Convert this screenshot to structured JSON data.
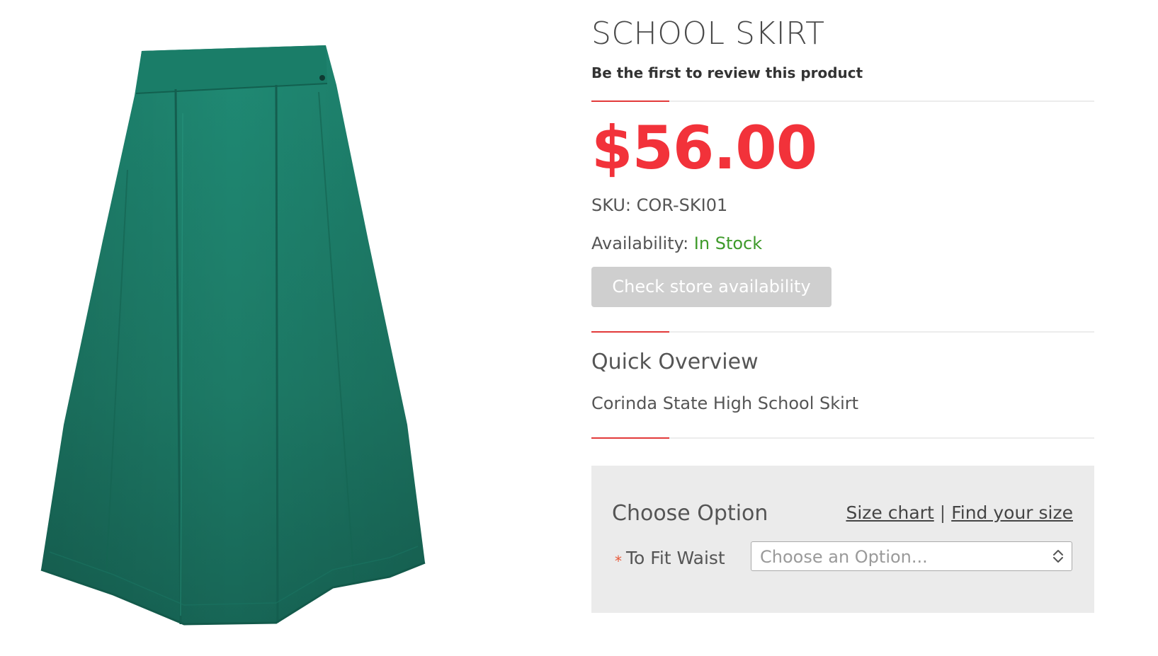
{
  "product": {
    "title": "SCHOOL SKIRT",
    "review_prompt": "Be the first to review this product",
    "price": "$56.00",
    "sku_label": "SKU:",
    "sku_value": "COR-SKI01",
    "availability_label": "Availability:",
    "availability_value": "In Stock",
    "check_store_label": "Check store availability",
    "image_color": "#1f7a66"
  },
  "overview": {
    "heading": "Quick Overview",
    "text": "Corinda State High School Skirt"
  },
  "options": {
    "heading": "Choose Option",
    "size_chart_label": "Size chart",
    "separator": "|",
    "find_size_label": "Find your size",
    "required_mark": "*",
    "waist_label": "To Fit Waist",
    "select_placeholder": "Choose an Option..."
  },
  "colors": {
    "price": "#f2323a",
    "accent_rule": "#e23a3a",
    "in_stock": "#3e9a2a",
    "button_bg": "#cfcfcf",
    "panel_bg": "#ebebeb"
  }
}
